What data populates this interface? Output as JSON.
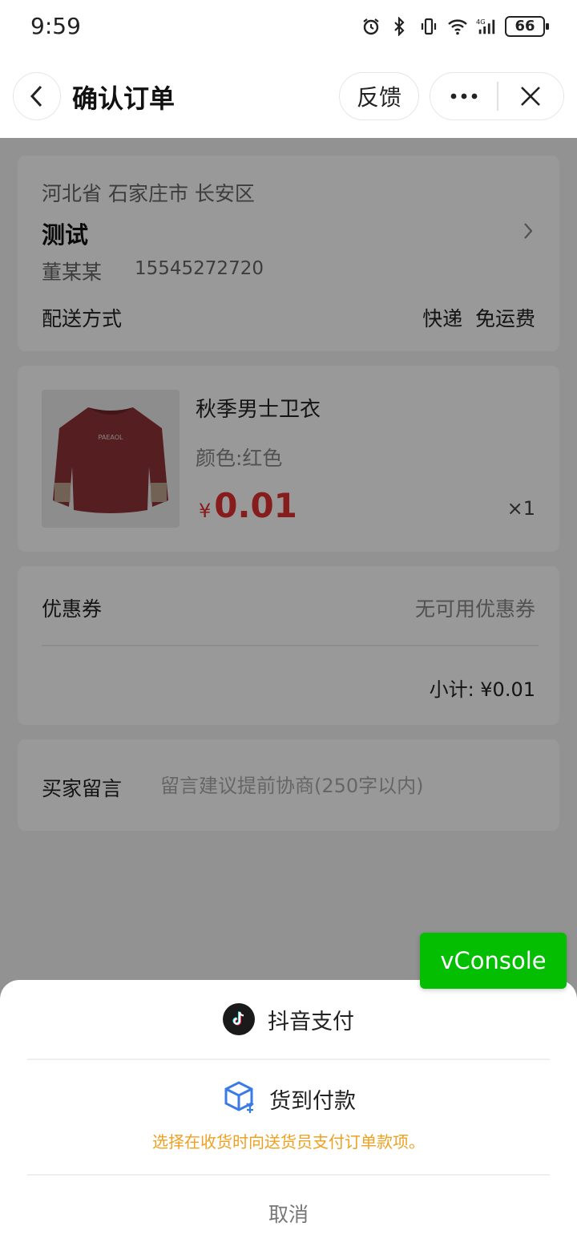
{
  "status_bar": {
    "time": "9:59",
    "battery": "66"
  },
  "nav": {
    "title": "确认订单",
    "feedback": "反馈"
  },
  "address": {
    "region": "河北省 石家庄市 长安区",
    "detail": "测试",
    "name": "董某某",
    "phone": "15545272720",
    "shipping_label": "配送方式",
    "shipping_value": "快递  免运费"
  },
  "product": {
    "name": "秋季男士卫衣",
    "spec": "颜色:红色",
    "currency": "¥",
    "price": "0.01",
    "quantity": "×1",
    "print_text": "PAEAOL",
    "color": "#8e3236"
  },
  "coupon": {
    "label": "优惠券",
    "value": "无可用优惠券",
    "subtotal": "小计: ¥0.01"
  },
  "message": {
    "label": "买家留言",
    "placeholder": "留言建议提前协商(250字以内)"
  },
  "vconsole": {
    "label": "vConsole",
    "color": "#04be02"
  },
  "payment_sheet": {
    "options": [
      {
        "label": "抖音支付",
        "icon": "douyin-icon"
      },
      {
        "label": "货到付款",
        "icon": "cod-box-icon",
        "hint": "选择在收货时向送货员支付订单款项。"
      }
    ],
    "cancel": "取消",
    "hint_color": "#f0a020"
  }
}
